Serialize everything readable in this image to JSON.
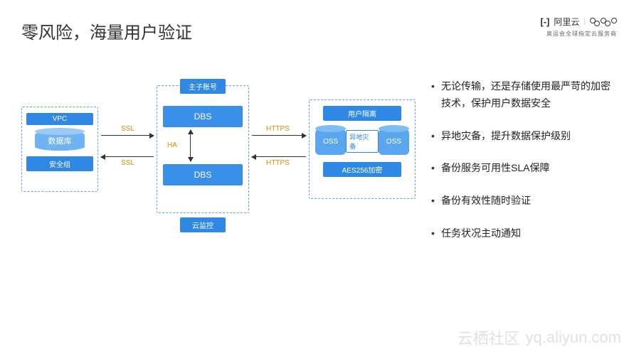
{
  "title": "零风险，海量用户验证",
  "logo": {
    "brand": "阿里云",
    "sub": "奥运会全球指定云服务商"
  },
  "diagram": {
    "left": {
      "vpc": "VPC",
      "db_label": "数据库",
      "secgroup": "安全组"
    },
    "mid": {
      "top_tag": "主子账号",
      "dbs1": "DBS",
      "ha": "HA",
      "dbs2": "DBS",
      "bottom_tag": "云监控"
    },
    "right": {
      "user_iso": "用户隔离",
      "oss1": "OSS",
      "dr_label": "异地灾备",
      "oss2": "OSS",
      "aes": "AES256加密"
    },
    "arrows": {
      "ssl1": "SSL",
      "ssl2": "SSL",
      "https1": "HTTPS",
      "https2": "HTTPS"
    }
  },
  "bullets": [
    "无论传输，还是存储使用最严苛的加密技术，保护用户数据安全",
    "异地灾备，提升数据保护级别",
    "备份服务可用性SLA保障",
    "备份有效性随时验证",
    "任务状况主动通知"
  ],
  "watermark": {
    "cn": "云栖社区",
    "url": "yq.aliyun.com"
  }
}
